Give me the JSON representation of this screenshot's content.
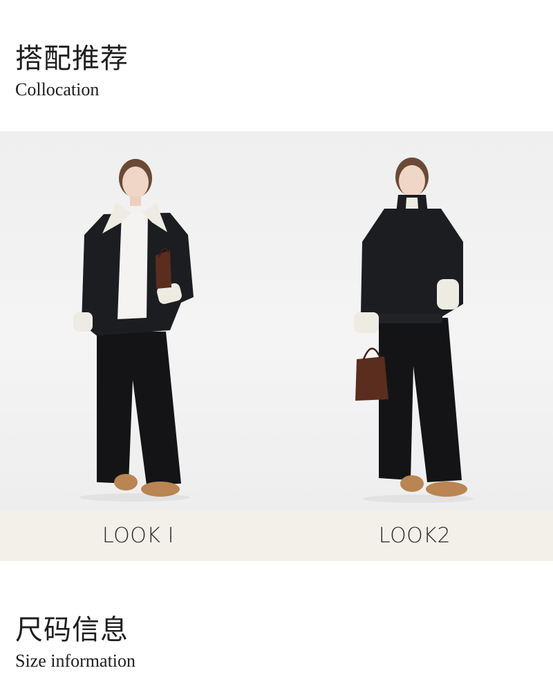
{
  "collocation": {
    "title_zh": "搭配推荐",
    "title_en": "Collocation"
  },
  "looks": [
    {
      "label": "LOOK I"
    },
    {
      "label": "LOOK2"
    }
  ],
  "size_info": {
    "title_zh": "尺码信息",
    "title_en": "Size information"
  },
  "colors": {
    "photo_background": "#f1f1f1",
    "label_band": "#f3f0ea",
    "jacket": "#1c1d20",
    "shearling": "#eeebe3",
    "trousers": "#141416",
    "boots": "#b98552",
    "bag": "#5a2d1f"
  }
}
